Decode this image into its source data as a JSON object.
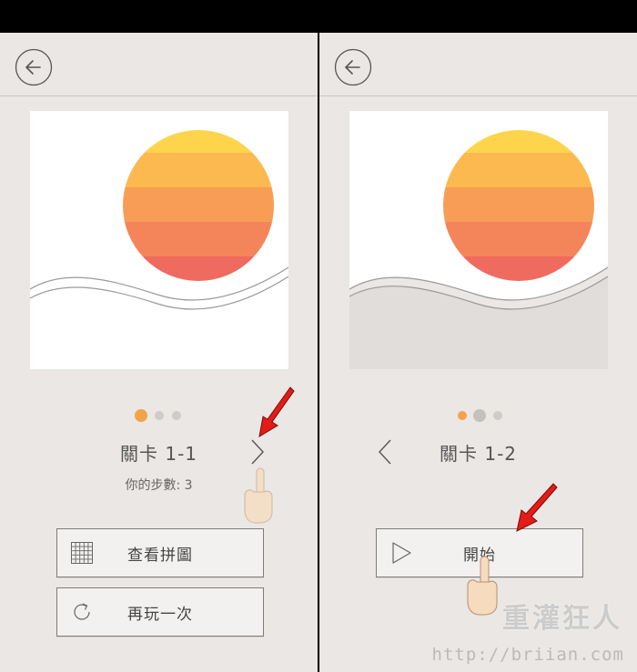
{
  "left": {
    "level_label": "關卡 1-1",
    "steps_label": "你的步數",
    "steps_value": "3",
    "steps_text": "你的步數: 3",
    "buttons": [
      {
        "label": "查看拼圖",
        "icon": "grid-icon"
      },
      {
        "label": "再玩一次",
        "icon": "replay-icon"
      }
    ],
    "page_dots": {
      "count": 3,
      "active": 0
    }
  },
  "right": {
    "level_label": "關卡 1-2",
    "start_button": {
      "label": "開始",
      "icon": "play-icon"
    },
    "page_dots": {
      "count": 3,
      "active": 1
    }
  },
  "watermark": {
    "logo_text": "重灌狂人",
    "url": "http://briian.com"
  },
  "colors": {
    "background": "#eae7e4",
    "sun_stripes": [
      "#fdd44b",
      "#fbb94f",
      "#f79d55",
      "#f4855b",
      "#ef6a5f"
    ],
    "active_dot": "#f3a24a",
    "arrow": "#e41b17"
  }
}
